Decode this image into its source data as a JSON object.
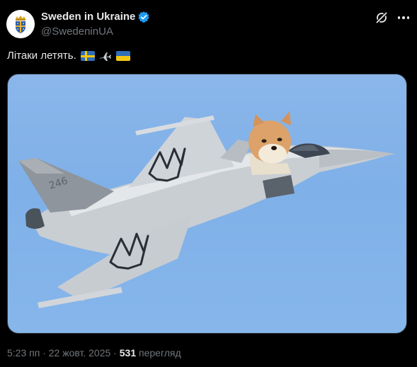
{
  "author": {
    "display_name": "Sweden in Ukraine",
    "handle": "@SwedeninUA",
    "verified": true,
    "avatar_icon": "swedish-crown-emblem-icon"
  },
  "actions": {
    "grok_icon": "grok-icon",
    "more_icon": "more-horizontal-icon"
  },
  "tweet": {
    "text": "Літаки летять.",
    "emojis": [
      "flag-sweden",
      "airplane",
      "flag-ukraine"
    ]
  },
  "media": {
    "content": "meme photo: cartoon dog sitting in the cockpit of a grey fighter jet with trident markings, number 246 on the tail",
    "sky_color": "#7fb0e8"
  },
  "meta": {
    "time": "5:23 пп",
    "separator1": " · ",
    "date": "22 жовт. 2025",
    "separator2": " · ",
    "views_count": "531",
    "views_label": " перегляд"
  },
  "colors": {
    "background": "#000000",
    "text_primary": "#e7e9ea",
    "text_secondary": "#71767b",
    "verified": "#1d9bf0",
    "border": "#2f3336"
  }
}
